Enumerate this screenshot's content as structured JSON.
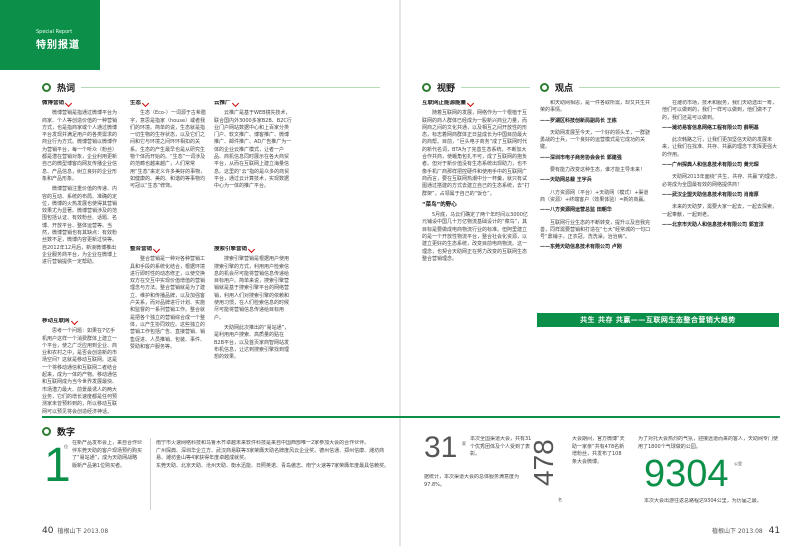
{
  "corner": {
    "en": "Special Report",
    "cn": "特别报道"
  },
  "sections": {
    "hot": "热词",
    "view": "视野",
    "opinion": "观点",
    "numbers": "数字"
  },
  "hot": {
    "weibo": {
      "title": "微博营销",
      "p1": "微博营销是指通过微博平台为商家、个人等创造价值的一种营销方式，也是指商家或个人通过微博平台发现并满足用户的各类需求的商业行为方式。微博营销以微博作为营销平台，每一个听众（粉丝）都是潜在营销对象，企业利用更新自己的微型博客向网友传播企业信息、产品信息，树立良好的企业形象和产品形象。",
      "p2": "微博营销注重价值的传递、内容的互动、系统的布局、准确的定位，微博的火热发展也使得其营销效果尤为显著。微博营销涉及的范围包括认证、有效粉丝、话题、名博、开放平台、整体运营等。当然，微博营销也有其缺点：有效粉丝数不足，微博内容更新过快等。自2012年12月后，新浪微博推出企业服务商平台，为企业在微博上进行营销提供一定帮助。"
    },
    "mobile": {
      "title": "移动互联网",
      "p1": "思考一个问题：如果在7亿手机用户这样一个消费群体上建立一个平台，使之广泛应用到企业、商业和农村之中，是否会创造新的市场空间？这就是移动互联网。这是一个将移动通信和互联网二者结合起来，成为一体的产物。移动通信和互联网成为当今世界发展最快、市场潜力最大、前景最诱人的两大业务，它们的增长速度都是任何预测家未曾预料到的，所以移动互联网可以预见将会创造经济神话。"
    },
    "eco": {
      "title": "生态",
      "p1": "生态（Eco-）一词源于古希腊字，意思是指家（house）或者我们的环境。简单的说，生态就是指一切生物的生存状态，以及它们之间和它与环境之间环环相扣的关系。生态的产生最早也是从研究生物个体而开始的。“生态”一词涉及的范畴也越来越广，人们常常用“生态”来定义许多美好的事物，如健康的、美的、和谐的等事物均可冠以“生态”修饰。"
    },
    "market": {
      "title": "整合营销",
      "p1": "整合营销是一种对各种营销工具和手段的系统化结合，根据环境进行即时性的动态修正，以使交换双方在交互中实现价值增值的营销理念与方法。整合营销就是为了建立、维护和传播品牌，以及加强客户关系，而对品牌进行计划、实施和监督的一系列营销工作。整合就是把各个独立的营销综合成一个整体，以产生协同效应。这些独立的营销工作包括广告、直接营销、销售促进、人员推销、包装、事件、赞助和客户服务等。"
    },
    "cloud": {
      "title": "云推广",
      "p1": "云推广是基于WEB镜先技术，联合国内外3000多家B2B、B2C行业门户网站数据中心和上百家分类门户、软文推广、博客推广、微博推广、邮件推广、AD广告推广为一体的企业云推广模式，让者一户品、商机信息同时展示在各大商贸平台，从而在互联网上建立海量信息。这里的“云”指的是众多的商贸平台，通过云计算技术，实现数据中心为一体的推广平台。"
    },
    "search": {
      "title": "搜索引擎营销",
      "p1": "搜索引擎营销是根据用户使用搜索引擎的方式，利用用户检索信息的机会尽可能将营销信息传递给目标用户。简单来说，搜索引擎营销就是基于搜索引擎平台的网络营销，利用人们对搜索引擎的依赖和使用习惯，在人们检索信息的时候尽可能将营销信息传递给目标用户。",
      "p2": "天助网此次推出的“易站通”，是利用用户搜索、高质量的贴在B2B平台，以及首页家商智网站发布机信息，让达到搜索引擎找到理想的效果。"
    }
  },
  "view": {
    "title": "互联网正能源能量",
    "p1": "随着互联网的发展，网络作为一个根植于互联网的商人群体已经成为一股新兴商业力量，而网商之间的文化共通，以及相互之间开放性的形态，标志着网商群体正日益成长为中国目前最大的商帮。目前，“巨头电子商务”成了互联网时代的新代名词，BTA为了完善生态系统，不断加大合作共商，使蛾角包扎不可，成了互联网的抱负者。但对于新价值没有生态系统出现助力，也不像手机厂商那样把控硬件和使用手中的互联网广商而言，要在互联网热潮中分一杯羹，就只有试图通过搭建的方式去建立自己的生态系统，去“打群架”，占领属于自己的“饭仓”。",
    "sub": "“菜鸟”的野心",
    "p2": "5月底，马云们确定了两个年时间以3000亿元铺设中国几十万亿物流基础设计的“菜鸟”，其目标是要做成电商物流行业的标准。但阿里建立的是一个开放性物流平台，整合社会化资源，以建立更好的生态系统，改变目前电商物流。这一理念，也契合天助网正在努力改变的互联网生态整合营销理念。"
  },
  "opinion": {
    "p0": "和天助网相思，是一件各取所需，却又共生共荣的事情。",
    "s0": "——罗湖区科技创新局副局长 王栋",
    "p1": "天助网发展至今天，一个好的领头羊，一群骁勇战的士兵，一个良好的运营模式是它成功的关键。",
    "s1": "——深圳市电子商务协会会长 郭建强",
    "p2": "要有能力改变这种生态，谁才能主导未来！",
    "s2": "——天助网总裁 王宇兵",
    "p3": "八方资源网（平台）+天助网（模式）+渠道商（资源）+终端客户（效果体验）=新的商赢。",
    "s3": "——八方资源网运营总监 田朝华",
    "p4": "互联网行业生态的不断转变，提升以及自我完善，同样需要营销和打造在“七大”经常城的一句口号“鼎铺子，正衣冠，洗洗澡，治治病”。",
    "s4": "——东莞天助信息技术有限公司 卢刚",
    "p5": "在潍坊市场，技术和服务，我们天助选出一筹，他们可以做到的，我们一样可以做到，他们做不了的，我们还是可以做到。",
    "s5": "——潍坊易客信息网络工程有限公司 薛明基",
    "p6": "此次韩路之行，让我们更加坚信天助的发展未来，让我们在找准、共存、共赢的理念下发挥更强大的作用。",
    "s6": "——广州探典人和信息技术有限公司 黄元琛",
    "p7": "天助网2013年面绕“共生、共存、共赢”的理念，必将成为全国最有效的网络提供商！",
    "s7": "——武汉企盟天助信息技术有限公司 肖南厚",
    "p8": "未来的天助梦，需要大家一起去，一起去探索，一起奉献，一起到老。",
    "s8": "——北京市天助人和信息技术有限公司 郭宜淳"
  },
  "banner": "共生 共存 共赢——互联网生态整合营销大趋势",
  "numbers": {
    "n1": {
      "value": "1",
      "unit": "位",
      "text": "在新产品发布会上，来自合作伙伴东莞天助的客户现场预约购买了“易站通”，成为天助网战略版新产品第1位购买者。"
    },
    "n2text": "南宁市火速网络科技和乌鲁木齐卓越未来软件科技是来自中国西部唯一2家参加大会的合作伙伴。",
    "cities": "广州探典、深圳华企立方、武汉商易联等3家荣膺天助名牌度风云企业奖。德州信通、郑州信康、潍坊商易、潍坊金山等4家获得年度卓越成就奖。",
    "prov": "东莞天助、北京天助、沧州天助、衡水迅能、日照英诺、青岛傲志、南宁火速等7家荣膺年度最具信赖奖。",
    "n3": {
      "value": "31",
      "unit": "家",
      "text": "本次全国渠道大会，共有31个优秀团体及个人受到了表彰。"
    },
    "n3b": "据统计，本次渠道大会的总体服务满意度为97.8%。",
    "n4": {
      "value": "478",
      "unit": "名",
      "text": "大会期间，官方微博“天助一家亲”共有478名新增粉丝，共发布了108条大会微博。"
    },
    "n5": {
      "value": "9304",
      "unit": "公里",
      "pre": "为了对托大会热烈的气氛，迎接远道而来的客人，天助网专门使用了1800个气球做的公园。",
      "text": "本次大会出游往返总路程达9304公里，为历届之最。"
    }
  },
  "footer": {
    "left_num": "40",
    "left_txt": "植根山下 2013.08",
    "right_num": "41",
    "right_txt": "植根山下 2013.08"
  }
}
